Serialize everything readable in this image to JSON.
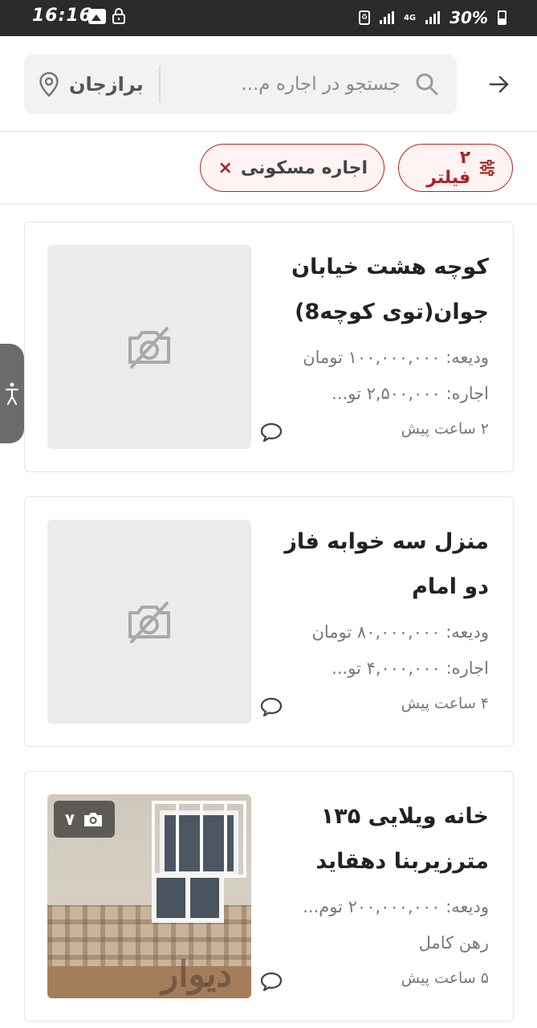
{
  "status_bar": {
    "time": "16:16",
    "network": "4G",
    "battery": "30%"
  },
  "header": {
    "search_placeholder": "جستجو در اجاره م...",
    "city": "برازجان"
  },
  "filters": {
    "filter_count_label": "۲ فیلتر",
    "category_label": "اجاره مسکونی",
    "category_close": "×"
  },
  "listings": [
    {
      "title": "کوچه هشت خیابان جوان(توی کوچه8)",
      "line1": "ودیعه: ۱۰۰,۰۰۰,۰۰۰ تومان",
      "line2": "اجاره: ۲,۵۰۰,۰۰۰ تو...",
      "time": "۲ ساعت پیش",
      "has_image": false
    },
    {
      "title": "منزل سه خوابه فاز دو امام",
      "line1": "ودیعه: ۸۰,۰۰۰,۰۰۰ تومان",
      "line2": "اجاره: ۴,۰۰۰,۰۰۰ تو...",
      "time": "۴ ساعت پیش",
      "has_image": false
    },
    {
      "title": "خانه ویلایی ۱۳۵ مترزیربنا دهقاید",
      "line1": "ودیعه: ۲۰۰,۰۰۰,۰۰۰ توم...",
      "line2": "رهن کامل",
      "time": "۵ ساعت پیش",
      "has_image": true,
      "photo_count": "۷",
      "watermark": "دیوار"
    }
  ],
  "colors": {
    "accent": "#a62626",
    "status_bar": "#2b2b2b",
    "search_bg": "#f2f2f2",
    "placeholder_bg": "#ebebeb"
  },
  "icons": [
    "arrow-right-icon",
    "search-icon",
    "location-pin-icon",
    "filter-sliders-icon",
    "close-icon",
    "no-image-camera-icon",
    "chat-bubble-icon",
    "camera-icon",
    "accessibility-icon"
  ]
}
